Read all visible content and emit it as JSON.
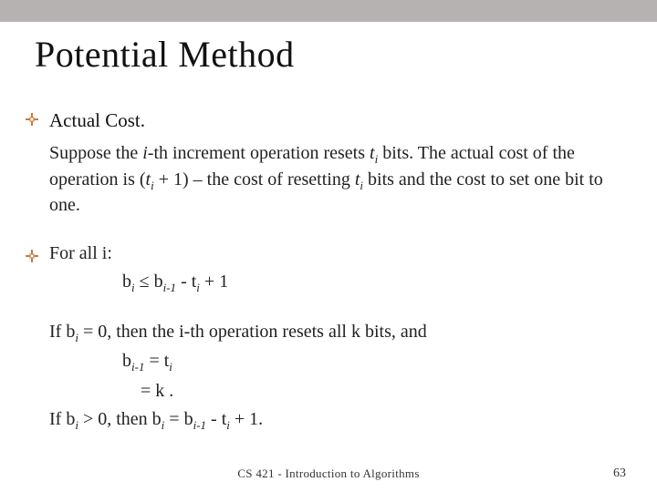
{
  "title": "Potential Method",
  "section_heading": "Actual Cost.",
  "para1_a": "Suppose the ",
  "para1_b": "i",
  "para1_c": "-th increment operation resets ",
  "para1_d": "t",
  "para1_e": " bits. The actual cost of the operation is (",
  "para1_f": "t",
  "para1_g": " + 1) – the cost of resetting ",
  "para1_h": "t",
  "para1_i": " bits and the cost to set one bit to one.",
  "forall_a": "For all ",
  "forall_b": "i",
  "forall_c": ":",
  "ineq_1": "b",
  "ineq_2": " ≤ ",
  "ineq_3": "b",
  "ineq_4": " - ",
  "ineq_5": "t",
  "ineq_6": "  +  1",
  "if0_a": "If ",
  "if0_b": "b",
  "if0_c": "   =   0, then the ",
  "if0_d": "i",
  "if0_e": "-th operation resets all ",
  "if0_f": "k",
  "if0_g": " bits, and",
  "eq1_a": "b",
  "eq1_b": " = ",
  "eq1_c": "t",
  "eq2_a": "   = ",
  "eq2_b": "k",
  "eq2_c": " .",
  "ifpos_a": "If ",
  "ifpos_b": "b",
  "ifpos_c": "  >  0, then ",
  "ifpos_d": "b",
  "ifpos_e": " = ",
  "ifpos_f": "b",
  "ifpos_g": " - ",
  "ifpos_h": "t",
  "ifpos_i": "  +  1.",
  "sub_i": "i",
  "sub_im1": "i-1",
  "footer": "CS 421 - Introduction to Algorithms",
  "pagenum": "63"
}
